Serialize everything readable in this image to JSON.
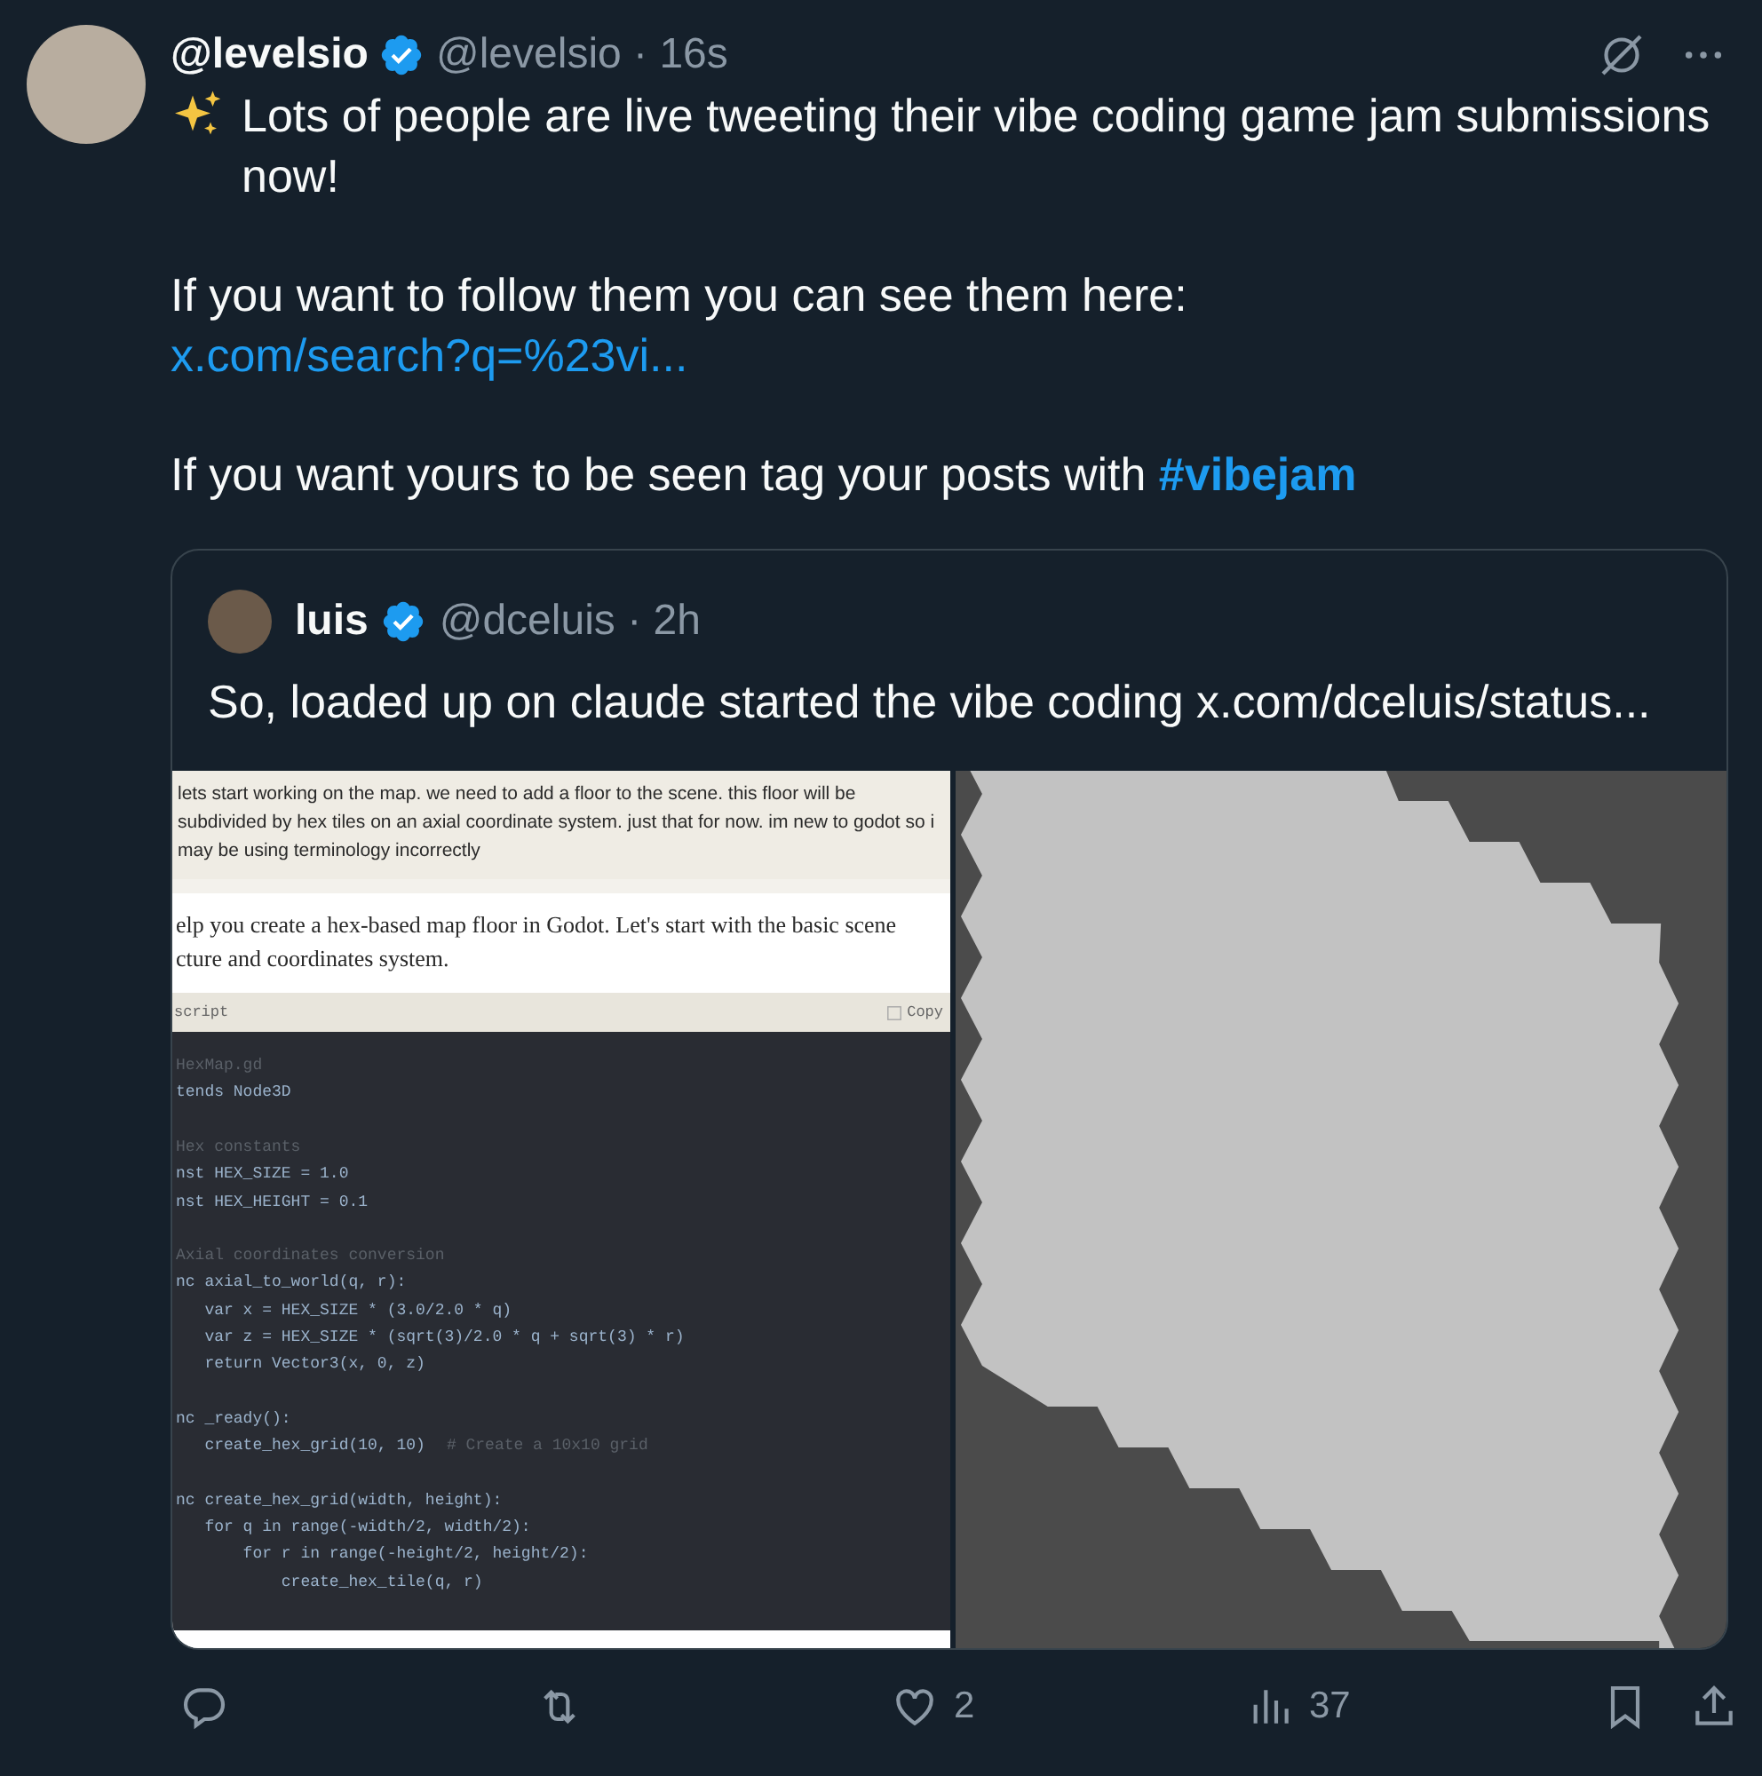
{
  "post": {
    "author": {
      "name": "@levelsio",
      "verified": true,
      "meta": "@levelsio · 16s"
    },
    "body": [
      {
        "kind": "sparkle_text",
        "text": "Lots of people are live tweeting their vibe coding game jam submissions now!"
      },
      {
        "kind": "text_with_link",
        "text": "If you want to follow them you can see them here:",
        "link": "x.com/search?q=%23vi..."
      },
      {
        "kind": "text_with_hashtag",
        "text": "If you want yours to be seen tag your posts with",
        "hashtag": "#vibejam"
      }
    ],
    "quote": {
      "author": {
        "name": "luis",
        "verified": true,
        "meta": "@dceluis · 2h"
      },
      "text": "So, loaded up on claude started the vibe coding",
      "link": "x.com/dceluis/status...",
      "chat": {
        "user_message": "lets start working on the map. we need to add a floor to the scene. this floor will be subdivided by hex tiles on an axial coordinate system. just that for now. im new to godot so i may be using terminology incorrectly",
        "reply": "elp you create a hex-based map floor in Godot. Let's start with the basic scene cture and coordinates system.",
        "code_language": "script",
        "copy_label": "Copy",
        "code_blocks": [
          [
            {
              "kind": "comment",
              "text": "HexMap.gd"
            },
            {
              "kind": "code",
              "text": "tends Node3D"
            }
          ],
          [
            {
              "kind": "comment",
              "text": "Hex constants"
            },
            {
              "kind": "code",
              "text": "nst HEX_SIZE = 1.0"
            },
            {
              "kind": "code",
              "text": "nst HEX_HEIGHT = 0.1"
            }
          ],
          [
            {
              "kind": "comment",
              "text": "Axial coordinates conversion"
            },
            {
              "kind": "code",
              "text": "nc axial_to_world(q, r):"
            },
            {
              "kind": "code",
              "text": "   var x = HEX_SIZE * (3.0/2.0 * q)"
            },
            {
              "kind": "code",
              "text": "   var z = HEX_SIZE * (sqrt(3)/2.0 * q + sqrt(3) * r)"
            },
            {
              "kind": "code",
              "text": "   return Vector3(x, 0, z)"
            }
          ],
          [
            {
              "kind": "code",
              "text": "nc _ready():"
            },
            {
              "kind": "code",
              "text": "   create_hex_grid(10, 10)",
              "comment": "# Create a 10x10 grid"
            }
          ],
          [
            {
              "kind": "code",
              "text": "nc create_hex_grid(width, height):"
            },
            {
              "kind": "code",
              "text": "   for q in range(-width/2, width/2):"
            },
            {
              "kind": "code",
              "text": "       for r in range(-height/2, height/2):"
            },
            {
              "kind": "code",
              "text": "           create_hex_tile(q, r)"
            }
          ]
        ]
      }
    },
    "actions": [
      {
        "kind": "reply"
      },
      {
        "kind": "repost"
      },
      {
        "kind": "like",
        "count": "2"
      },
      {
        "kind": "views",
        "count": "37"
      },
      {
        "kind": "bookmark"
      },
      {
        "kind": "share"
      }
    ]
  }
}
